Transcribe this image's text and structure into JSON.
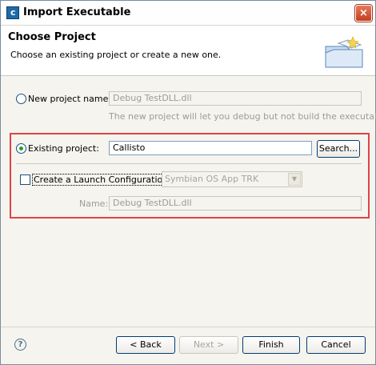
{
  "window": {
    "title": "Import Executable",
    "close_glyph": "×"
  },
  "header": {
    "title": "Choose Project",
    "description": "Choose an existing project or create a new one."
  },
  "new_project": {
    "label": "New project name:",
    "value": "Debug TestDLL.dll",
    "hint": "The new project will let you debug but not build the executable.",
    "selected": false
  },
  "existing_project": {
    "label": "Existing project:",
    "value": "Callisto",
    "search_button": "Search...",
    "selected": true
  },
  "launch_config": {
    "label": "Create a Launch Configuration.",
    "checked": false,
    "combo_value": "Symbian OS App TRK",
    "name_label": "Name:",
    "name_value": "Debug TestDLL.dll"
  },
  "footer": {
    "help_glyph": "?",
    "back": "< Back",
    "next": "Next >",
    "finish": "Finish",
    "cancel": "Cancel"
  },
  "icons": {
    "app": "c",
    "combo_arrow": "▼"
  },
  "colors": {
    "highlight_border": "#e04343",
    "radio_dot": "#21a121",
    "close_button": "#c23f1f"
  }
}
